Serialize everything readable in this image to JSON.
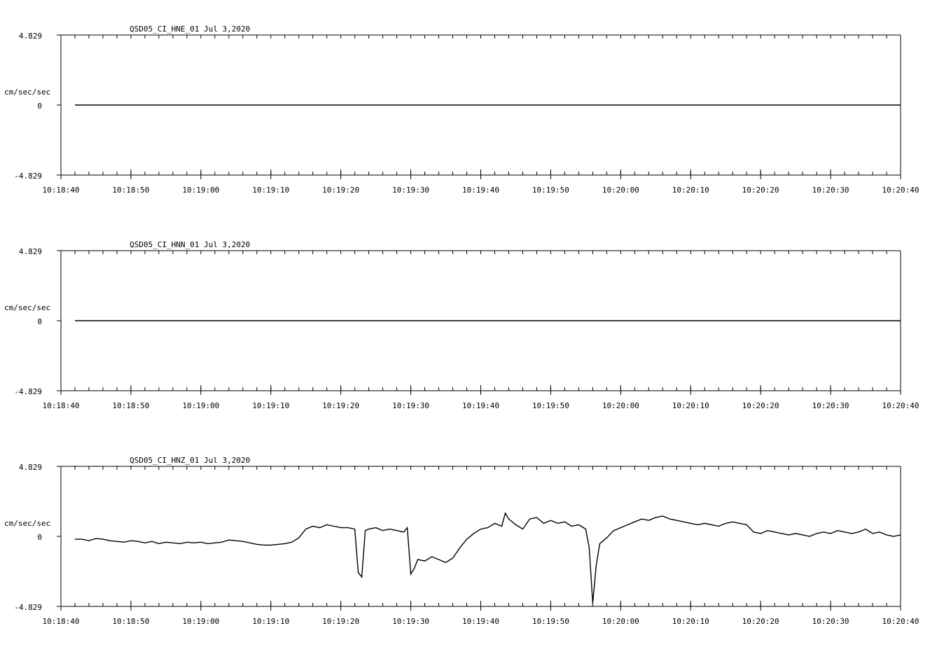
{
  "chart_data": [
    {
      "type": "line",
      "title": "QSD05_CI_HNE_01  Jul 3,2020",
      "ylabel": "cm/sec/sec",
      "ylim": [
        -4.829,
        4.829
      ],
      "y_ticks": [
        "4.829",
        "0",
        "-4.829"
      ],
      "x_ticks": [
        "10:18:40",
        "10:18:50",
        "10:19:00",
        "10:19:10",
        "10:19:20",
        "10:19:30",
        "10:19:40",
        "10:19:50",
        "10:20:00",
        "10:20:10",
        "10:20:20",
        "10:20:30",
        "10:20:40"
      ],
      "x_range_seconds_from_first_tick": [
        0,
        120
      ],
      "trace_start_second": 2,
      "series": [
        {
          "values": [
            [
              2,
              0
            ],
            [
              120,
              0
            ]
          ]
        }
      ]
    },
    {
      "type": "line",
      "title": "QSD05_CI_HNN_01  Jul 3,2020",
      "ylabel": "cm/sec/sec",
      "ylim": [
        -4.829,
        4.829
      ],
      "y_ticks": [
        "4.829",
        "0",
        "-4.829"
      ],
      "x_ticks": [
        "10:18:40",
        "10:18:50",
        "10:19:00",
        "10:19:10",
        "10:19:20",
        "10:19:30",
        "10:19:40",
        "10:19:50",
        "10:20:00",
        "10:20:10",
        "10:20:20",
        "10:20:30",
        "10:20:40"
      ],
      "x_range_seconds_from_first_tick": [
        0,
        120
      ],
      "trace_start_second": 2,
      "series": [
        {
          "values": [
            [
              2,
              0
            ],
            [
              120,
              0
            ]
          ]
        }
      ]
    },
    {
      "type": "line",
      "title": "QSD05_CI_HNZ_01  Jul 3,2020",
      "ylabel": "cm/sec/sec",
      "ylim": [
        -4.829,
        4.829
      ],
      "y_ticks": [
        "4.829",
        "0",
        "-4.829"
      ],
      "x_ticks": [
        "10:18:40",
        "10:18:50",
        "10:19:00",
        "10:19:10",
        "10:19:20",
        "10:19:30",
        "10:19:40",
        "10:19:50",
        "10:20:00",
        "10:20:10",
        "10:20:20",
        "10:20:30",
        "10:20:40"
      ],
      "x_range_seconds_from_first_tick": [
        0,
        120
      ],
      "trace_start_second": 2,
      "series": [
        {
          "values": [
            [
              2,
              -0.2
            ],
            [
              3,
              -0.2
            ],
            [
              4,
              -0.3
            ],
            [
              5,
              -0.15
            ],
            [
              6,
              -0.2
            ],
            [
              7,
              -0.3
            ],
            [
              8,
              -0.35
            ],
            [
              9,
              -0.4
            ],
            [
              10,
              -0.3
            ],
            [
              11,
              -0.35
            ],
            [
              12,
              -0.45
            ],
            [
              13,
              -0.35
            ],
            [
              14,
              -0.5
            ],
            [
              15,
              -0.4
            ],
            [
              16,
              -0.45
            ],
            [
              17,
              -0.5
            ],
            [
              18,
              -0.4
            ],
            [
              19,
              -0.45
            ],
            [
              20,
              -0.4
            ],
            [
              21,
              -0.5
            ],
            [
              22,
              -0.45
            ],
            [
              23,
              -0.4
            ],
            [
              24,
              -0.25
            ],
            [
              25,
              -0.3
            ],
            [
              26,
              -0.35
            ],
            [
              27,
              -0.45
            ],
            [
              28,
              -0.55
            ],
            [
              29,
              -0.6
            ],
            [
              30,
              -0.6
            ],
            [
              31,
              -0.55
            ],
            [
              32,
              -0.5
            ],
            [
              33,
              -0.4
            ],
            [
              34,
              -0.1
            ],
            [
              35,
              0.5
            ],
            [
              36,
              0.7
            ],
            [
              37,
              0.6
            ],
            [
              38,
              0.8
            ],
            [
              39,
              0.7
            ],
            [
              40,
              0.6
            ],
            [
              41,
              0.6
            ],
            [
              42,
              0.5
            ],
            [
              42.5,
              -2.5
            ],
            [
              43,
              -2.8
            ],
            [
              43.5,
              0.4
            ],
            [
              44,
              0.5
            ],
            [
              45,
              0.6
            ],
            [
              46,
              0.4
            ],
            [
              47,
              0.5
            ],
            [
              48,
              0.4
            ],
            [
              49,
              0.3
            ],
            [
              49.5,
              0.6
            ],
            [
              50,
              -2.6
            ],
            [
              50.5,
              -2.2
            ],
            [
              51,
              -1.6
            ],
            [
              52,
              -1.7
            ],
            [
              53,
              -1.4
            ],
            [
              54,
              -1.6
            ],
            [
              55,
              -1.8
            ],
            [
              56,
              -1.5
            ],
            [
              57,
              -0.8
            ],
            [
              58,
              -0.2
            ],
            [
              59,
              0.2
            ],
            [
              60,
              0.5
            ],
            [
              61,
              0.6
            ],
            [
              62,
              0.9
            ],
            [
              63,
              0.7
            ],
            [
              63.5,
              1.6
            ],
            [
              64,
              1.2
            ],
            [
              65,
              0.8
            ],
            [
              66,
              0.5
            ],
            [
              67,
              1.2
            ],
            [
              68,
              1.3
            ],
            [
              69,
              0.9
            ],
            [
              70,
              1.1
            ],
            [
              71,
              0.9
            ],
            [
              72,
              1.0
            ],
            [
              73,
              0.7
            ],
            [
              74,
              0.8
            ],
            [
              75,
              0.5
            ],
            [
              75.5,
              -0.8
            ],
            [
              76,
              -4.6
            ],
            [
              76.5,
              -2.0
            ],
            [
              77,
              -0.5
            ],
            [
              78,
              -0.1
            ],
            [
              79,
              0.4
            ],
            [
              80,
              0.6
            ],
            [
              81,
              0.8
            ],
            [
              82,
              1.0
            ],
            [
              83,
              1.2
            ],
            [
              84,
              1.1
            ],
            [
              85,
              1.3
            ],
            [
              86,
              1.4
            ],
            [
              87,
              1.2
            ],
            [
              88,
              1.1
            ],
            [
              89,
              1.0
            ],
            [
              90,
              0.9
            ],
            [
              91,
              0.8
            ],
            [
              92,
              0.9
            ],
            [
              93,
              0.8
            ],
            [
              94,
              0.7
            ],
            [
              95,
              0.9
            ],
            [
              96,
              1.0
            ],
            [
              97,
              0.9
            ],
            [
              98,
              0.8
            ],
            [
              99,
              0.3
            ],
            [
              100,
              0.2
            ],
            [
              101,
              0.4
            ],
            [
              102,
              0.3
            ],
            [
              103,
              0.2
            ],
            [
              104,
              0.1
            ],
            [
              105,
              0.2
            ],
            [
              106,
              0.1
            ],
            [
              107,
              0.0
            ],
            [
              108,
              0.2
            ],
            [
              109,
              0.3
            ],
            [
              110,
              0.2
            ],
            [
              111,
              0.4
            ],
            [
              112,
              0.3
            ],
            [
              113,
              0.2
            ],
            [
              114,
              0.3
            ],
            [
              115,
              0.5
            ],
            [
              116,
              0.2
            ],
            [
              117,
              0.3
            ],
            [
              118,
              0.1
            ],
            [
              119,
              0.0
            ],
            [
              120,
              0.1
            ]
          ]
        }
      ]
    }
  ]
}
